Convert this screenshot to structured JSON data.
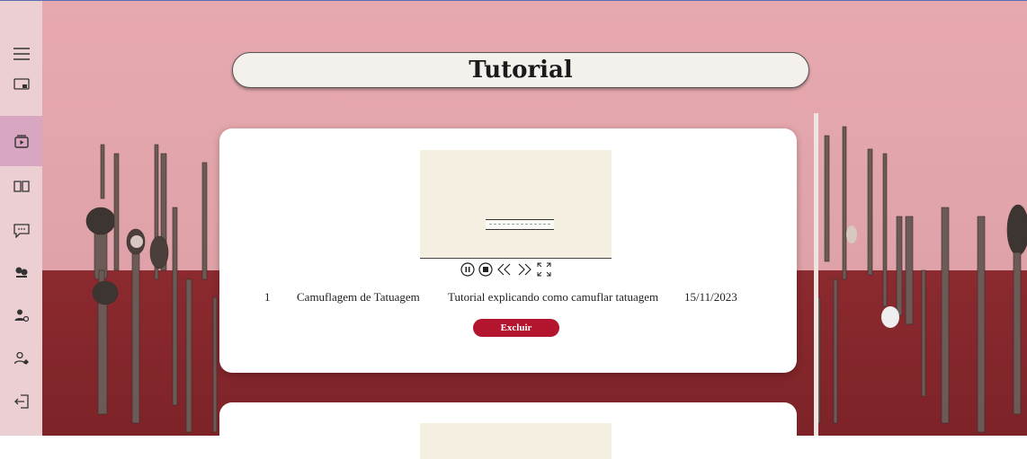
{
  "sidebar": {
    "items": [
      {
        "icon": "menu-icon",
        "active": false
      },
      {
        "icon": "screen-user-icon",
        "active": false
      },
      {
        "icon": "video-library-icon",
        "active": true
      },
      {
        "icon": "book-icon",
        "active": false
      },
      {
        "icon": "chat-icon",
        "active": false
      },
      {
        "icon": "users-icon",
        "active": false
      },
      {
        "icon": "user-add-icon",
        "active": false
      },
      {
        "icon": "user-settings-icon",
        "active": false
      },
      {
        "icon": "logout-icon",
        "active": false
      }
    ]
  },
  "header": {
    "title": "Tutorial"
  },
  "tutorials": [
    {
      "id": "1",
      "name": "Camuflagem de Tatuagem",
      "description": "Tutorial explicando como camuflar tatuagem",
      "date": "15/11/2023",
      "delete_label": "Excluir",
      "controls": [
        "pause-icon",
        "stop-icon",
        "rewind-icon",
        "fast-forward-icon",
        "fullscreen-icon"
      ]
    }
  ],
  "colors": {
    "sidebar_bg": "#eccfd3",
    "sidebar_active": "#d9a6c1",
    "delete_button": "#b3142e",
    "wall_top": "#e7a9af",
    "wall_bottom": "#8b2a2f"
  }
}
